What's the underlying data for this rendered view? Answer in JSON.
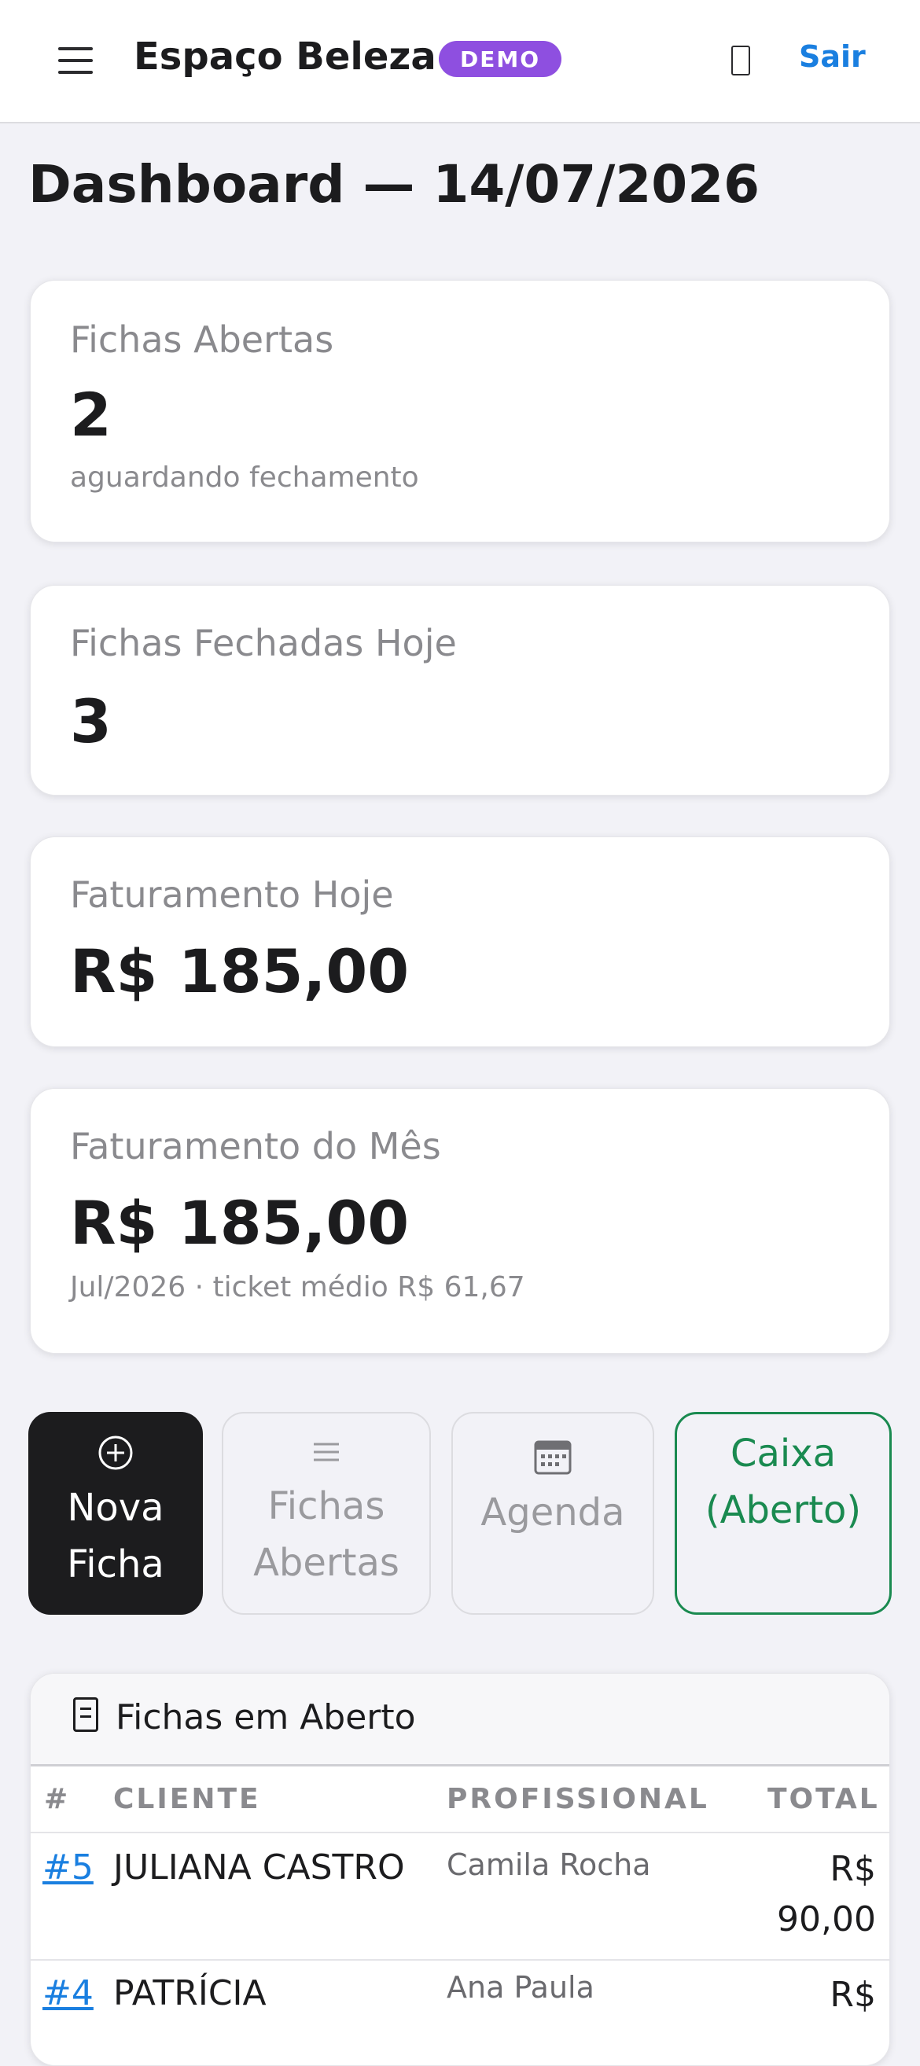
{
  "header": {
    "app_title": "Espaço Beleza",
    "badge": "DEMO",
    "logout_label": "Sair"
  },
  "page": {
    "title": "Dashboard — 14/07/2026"
  },
  "cards": [
    {
      "label": "Fichas Abertas",
      "value": "2",
      "sub": "aguardando fechamento"
    },
    {
      "label": "Fichas Fechadas Hoje",
      "value": "3",
      "sub": ""
    },
    {
      "label": "Faturamento Hoje",
      "value": "R$ 185,00",
      "sub": ""
    },
    {
      "label": "Faturamento do Mês",
      "value": "R$ 185,00",
      "sub": "Jul/2026 · ticket médio R$ 61,67"
    }
  ],
  "actions": {
    "nova_ficha": [
      "Nova",
      "Ficha"
    ],
    "fichas_abertas": [
      "Fichas",
      "Abertas"
    ],
    "agenda": [
      "Agenda"
    ],
    "caixa": [
      "Caixa",
      "(Aberto)"
    ]
  },
  "open_tickets": {
    "title": "Fichas em Aberto",
    "columns": [
      "#",
      "CLIENTE",
      "PROFISSIONAL",
      "TOTAL"
    ],
    "rows": [
      {
        "id": "#5",
        "client": "JULIANA CASTRO",
        "professional": "Camila Rocha",
        "total_line1": "R$",
        "total_line2": "90,00"
      },
      {
        "id": "#4",
        "client": "PATRÍCIA",
        "professional": "Ana Paula",
        "total_line1": "R$",
        "total_line2": ""
      }
    ]
  },
  "colors": {
    "accent": "#1a7fe0",
    "badge": "#8e4fe0",
    "caixa_open": "#1a8a50",
    "primary_button": "#1c1c1e"
  },
  "icons": {
    "menu": "hamburger-icon",
    "notifications": "notification-icon",
    "nova_ficha": "plus-circle-icon",
    "fichas_abertas": "list-icon",
    "agenda": "calendar-icon",
    "table": "document-icon"
  }
}
